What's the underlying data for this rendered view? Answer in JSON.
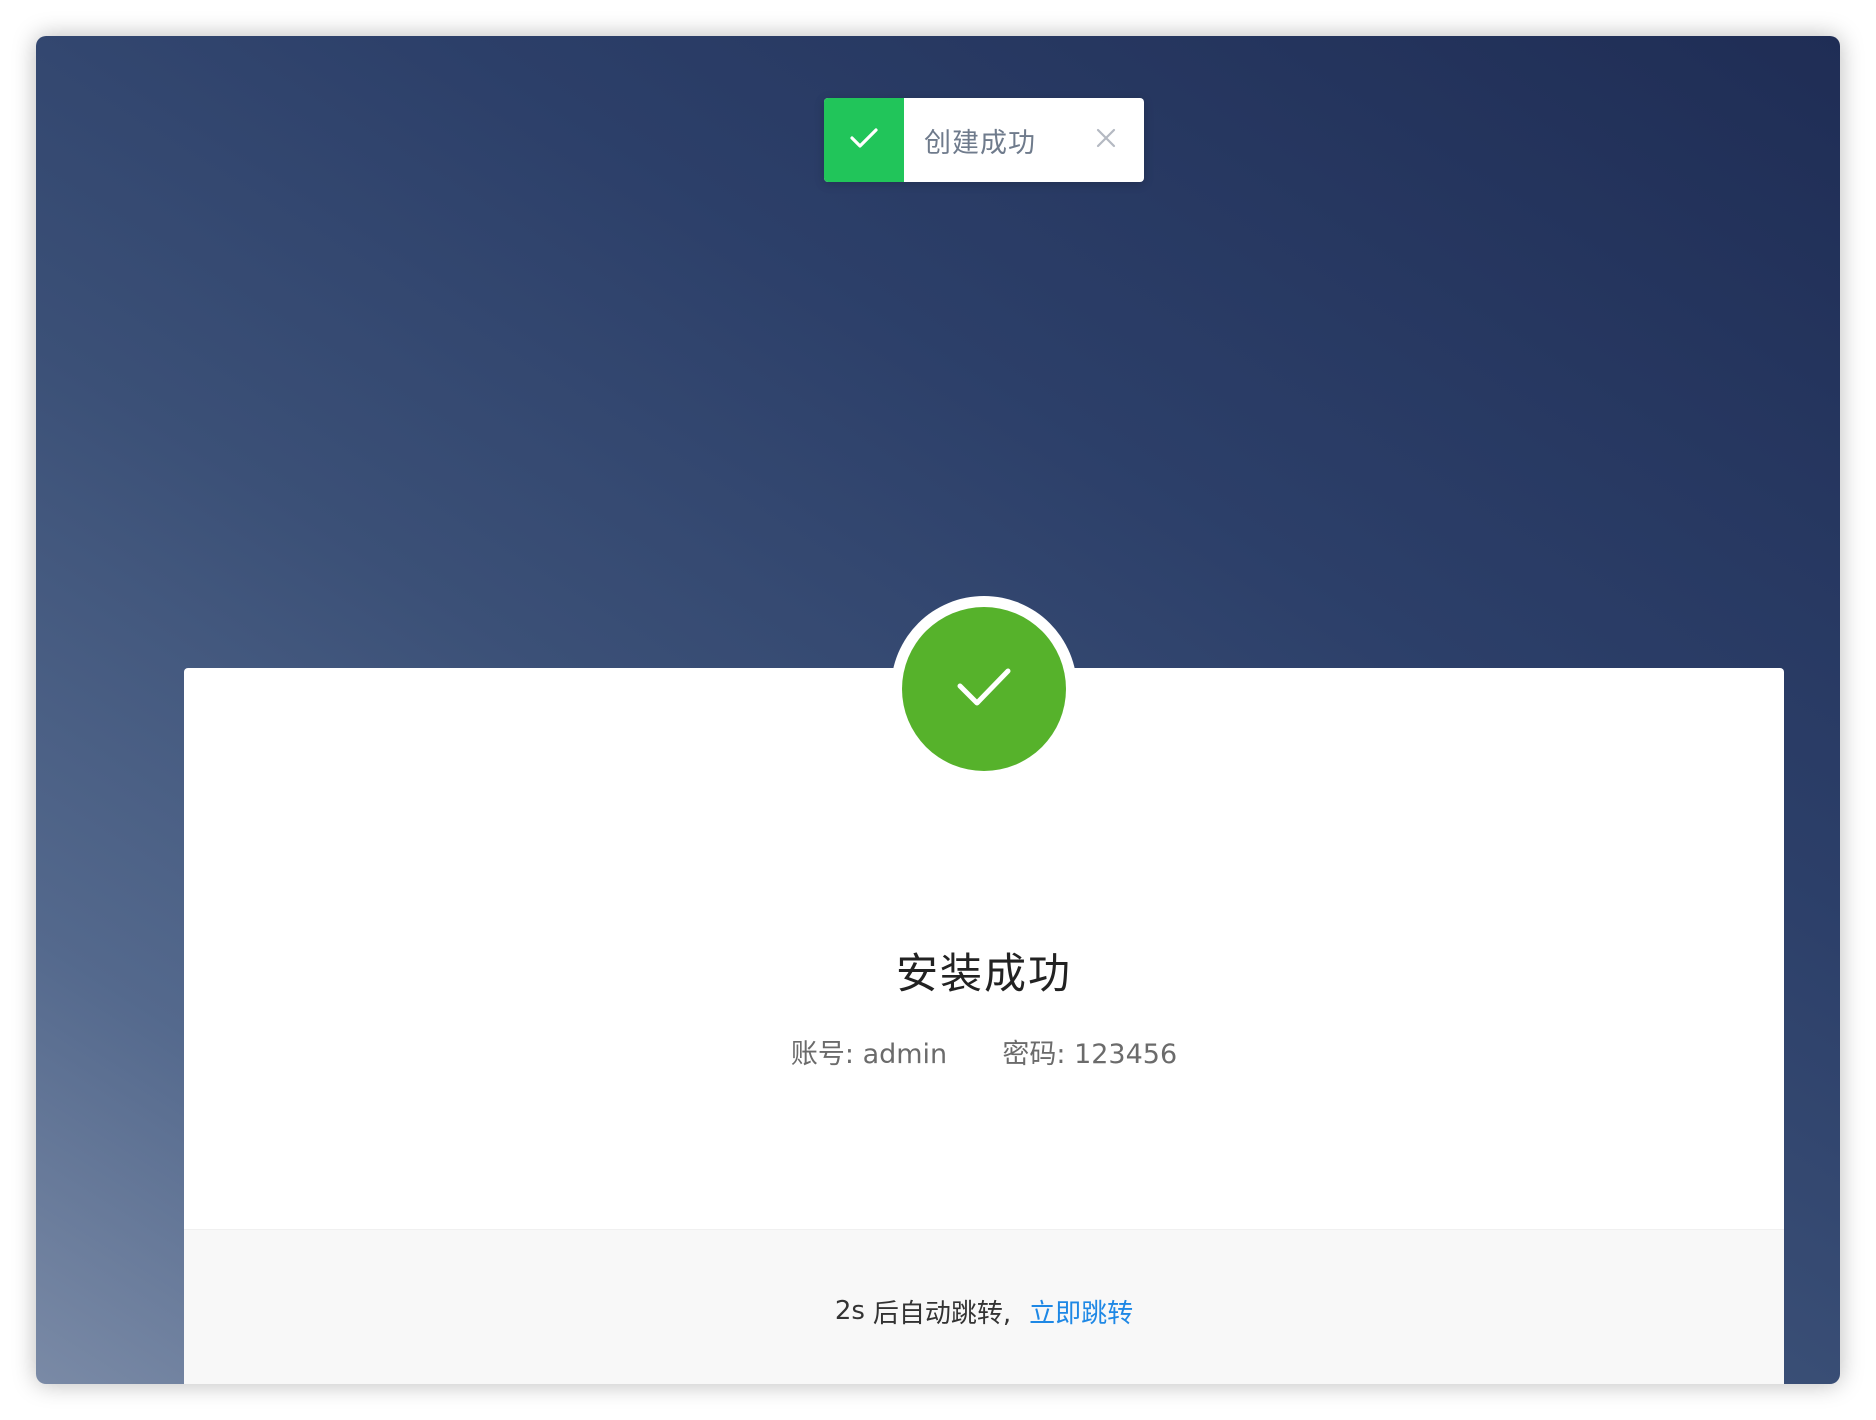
{
  "toast": {
    "message": "创建成功",
    "status_icon": "check-icon",
    "close_icon": "close-icon",
    "accent_color": "#21c55a"
  },
  "result": {
    "icon": "check-icon",
    "icon_color": "#56b22b",
    "title": "安装成功",
    "account_label": "账号:",
    "account_value": "admin",
    "password_label": "密码:",
    "password_value": "123456"
  },
  "footer": {
    "seconds": "2s",
    "countdown_text": "后自动跳转,",
    "link_label": "立即跳转",
    "link_color": "#1e88e5"
  }
}
